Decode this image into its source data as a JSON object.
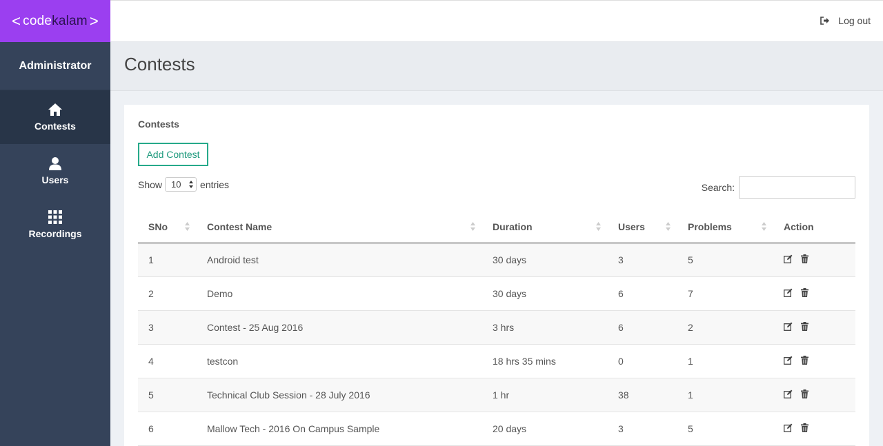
{
  "brand": {
    "lt": "<",
    "part1": "code",
    "part2": "kalam",
    "gt": ">"
  },
  "sidebar": {
    "role": "Administrator",
    "items": [
      {
        "label": "Contests",
        "icon": "home-icon",
        "active": true
      },
      {
        "label": "Users",
        "icon": "user-icon",
        "active": false
      },
      {
        "label": "Recordings",
        "icon": "grid-icon",
        "active": false
      }
    ]
  },
  "topbar": {
    "logout_label": "Log out",
    "logout_icon": "sign-out-icon"
  },
  "page": {
    "title": "Contests"
  },
  "panel": {
    "title": "Contests",
    "add_button": "Add Contest",
    "show_label": "Show",
    "entries_value": "10",
    "entries_label": "entries",
    "search_label": "Search:",
    "search_value": ""
  },
  "table": {
    "columns": [
      "SNo",
      "Contest Name",
      "Duration",
      "Users",
      "Problems",
      "Action"
    ],
    "rows": [
      {
        "sno": "1",
        "name": "Android test",
        "duration": "30 days",
        "users": "3",
        "problems": "5"
      },
      {
        "sno": "2",
        "name": "Demo",
        "duration": "30 days",
        "users": "6",
        "problems": "7"
      },
      {
        "sno": "3",
        "name": "Contest - 25 Aug 2016",
        "duration": "3 hrs",
        "users": "6",
        "problems": "2"
      },
      {
        "sno": "4",
        "name": "testcon",
        "duration": "18 hrs 35 mins",
        "users": "0",
        "problems": "1"
      },
      {
        "sno": "5",
        "name": "Technical Club Session - 28 July 2016",
        "duration": "1 hr",
        "users": "38",
        "problems": "1"
      },
      {
        "sno": "6",
        "name": "Mallow Tech - 2016 On Campus Sample",
        "duration": "20 days",
        "users": "3",
        "problems": "5"
      }
    ]
  },
  "colors": {
    "brand": "#9b3ff0",
    "sidebar": "#35435a",
    "accent": "#26a98a"
  }
}
